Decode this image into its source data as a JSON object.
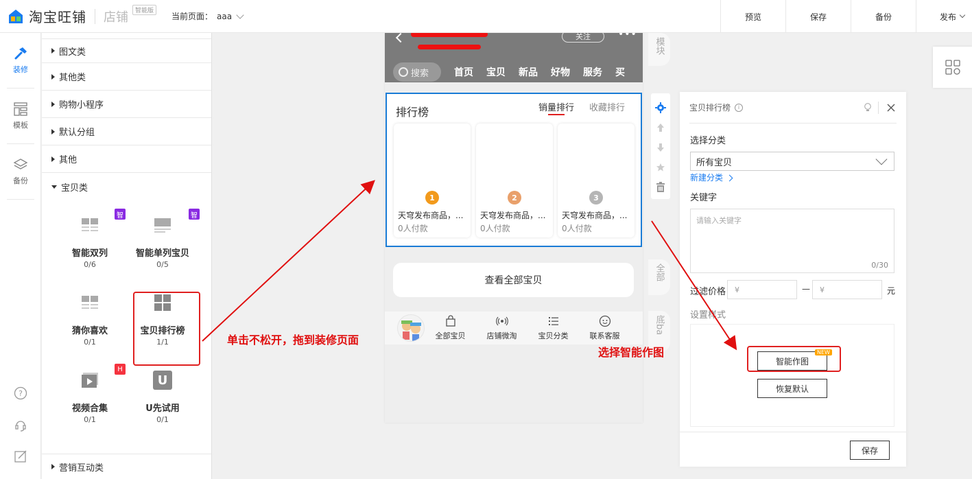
{
  "brand": {
    "name": "淘宝旺铺",
    "sub": "店铺",
    "tag": "智能版"
  },
  "current_page": {
    "label": "当前页面：",
    "value": "aaa"
  },
  "top_actions": [
    "预览",
    "保存",
    "备份",
    "发布"
  ],
  "rail": [
    {
      "label": "装修",
      "icon": "hammer-icon"
    },
    {
      "label": "模板",
      "icon": "template-icon"
    },
    {
      "label": "备份",
      "icon": "layers-icon"
    }
  ],
  "categories": {
    "top": [
      "图文类",
      "其他类",
      "购物小程序",
      "默认分组",
      "其他",
      "宝贝类"
    ],
    "bottom": "营销互动类"
  },
  "widgets": [
    {
      "name": "智能双列",
      "count": "0/6",
      "badge": "智"
    },
    {
      "name": "智能单列宝贝",
      "count": "0/5",
      "badge": "智"
    },
    {
      "name": "猜你喜欢",
      "count": "0/1",
      "badge": ""
    },
    {
      "name": "宝贝排行榜",
      "count": "1/1",
      "badge": ""
    },
    {
      "name": "视频合集",
      "count": "0/1",
      "badge": "H"
    },
    {
      "name": "U先试用",
      "count": "0/1",
      "badge": "",
      "glyph": "U"
    }
  ],
  "phone": {
    "follow": "关注",
    "more": "•••",
    "search": "搜索",
    "nav": [
      "首页",
      "宝贝",
      "新品",
      "好物",
      "服务",
      "买"
    ],
    "rank": {
      "title": "排行榜",
      "tab_active": "销量排行",
      "tab_other": "收藏排行",
      "cards": [
        {
          "rank": "1",
          "name": "天穹发布商品，...",
          "paid": "0人付款",
          "color": "#f29a1c"
        },
        {
          "rank": "2",
          "name": "天穹发布商品，...",
          "paid": "0人付款",
          "color": "#e9a06b"
        },
        {
          "rank": "3",
          "name": "天穹发布商品，...",
          "paid": "0人付款",
          "color": "#b5b5b5"
        }
      ]
    },
    "view_all": "查看全部宝贝",
    "footer": [
      "全部宝贝",
      "店铺微淘",
      "宝贝分类",
      "联系客服"
    ]
  },
  "side_tabs": {
    "module": "模块",
    "all": "全部",
    "bottom": "底ba"
  },
  "right_panel": {
    "title": "宝贝排行榜",
    "select_category_label": "选择分类",
    "select_value": "所有宝贝",
    "new_category_link": "新建分类",
    "keyword_label": "关键字",
    "keyword_placeholder": "请输入关键字",
    "keyword_count": "0/30",
    "price_label": "过滤价格",
    "price_placeholder_min": "¥",
    "price_placeholder_max": "¥",
    "price_sep": "—",
    "price_unit": "元",
    "style_label": "设置样式",
    "smart_btn": "智能作图",
    "new_tag": "NEW",
    "reset_btn": "恢复默认",
    "save_btn": "保存"
  },
  "annotations": {
    "drag": "单击不松开，拖到装修页面",
    "choose": "选择智能作图"
  },
  "colors": {
    "accent": "#1a7cf0",
    "annotation": "#e01010",
    "select_border": "#1a7cd6"
  }
}
